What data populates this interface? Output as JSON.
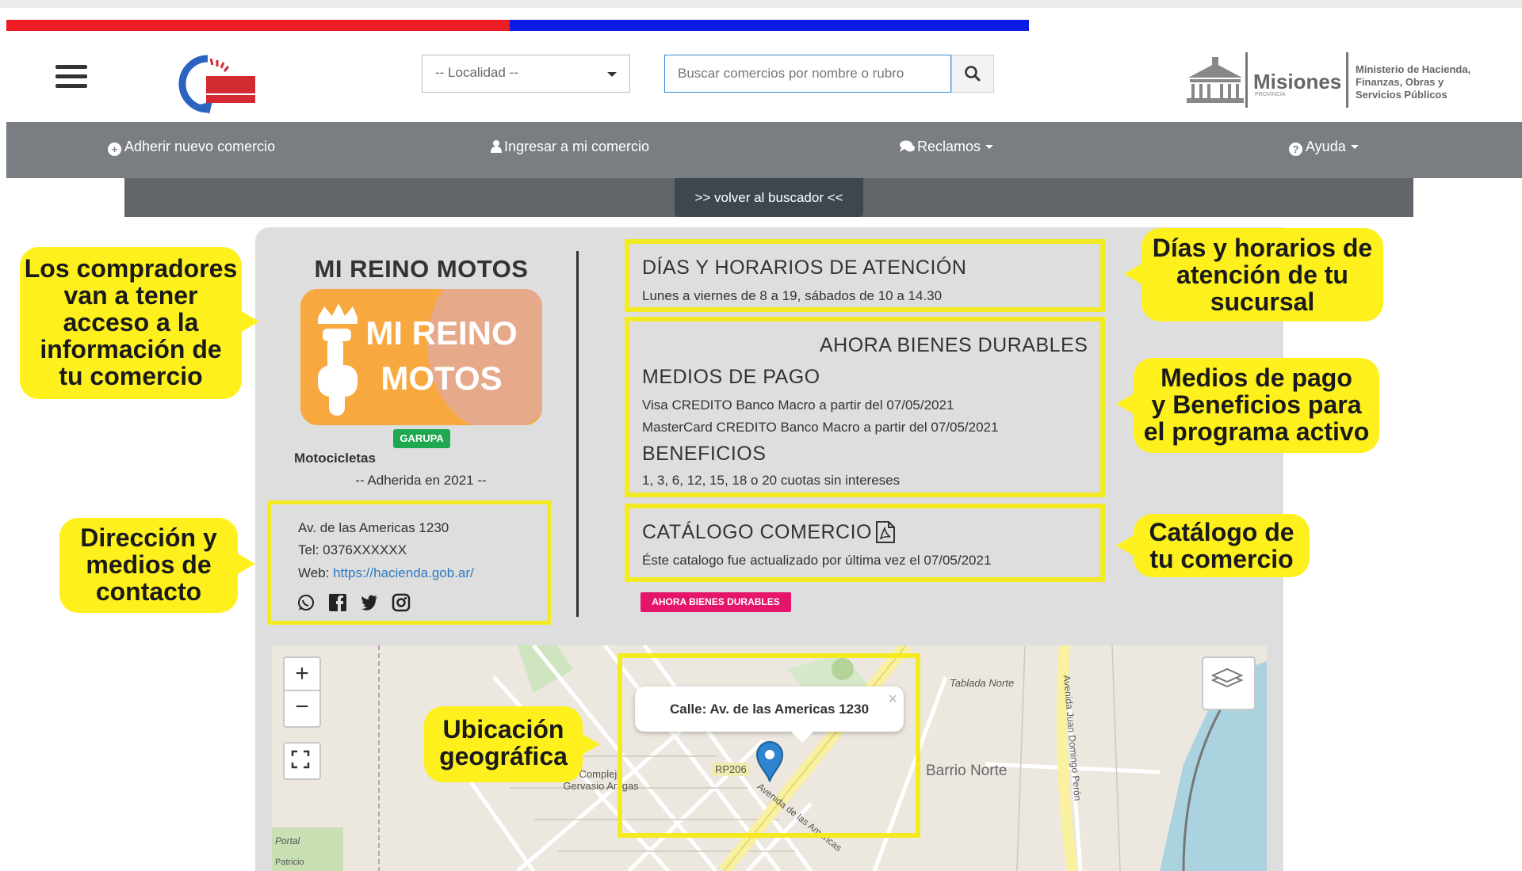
{
  "header": {
    "localidad_placeholder": "-- Localidad --",
    "search_placeholder": "Buscar comercios por nombre o rubro",
    "ministry_name": "Misiones",
    "ministry_subtitle": "PROVINCIA",
    "ministry_text": [
      "Ministerio de Hacienda,",
      "Finanzas, Obras y",
      "Servicios Públicos"
    ]
  },
  "nav": {
    "adherir": "Adherir nuevo comercio",
    "ingresar": "Ingresar a mi comercio",
    "reclamos": "Reclamos",
    "ayuda": "Ayuda",
    "volver": ">> volver al buscador <<"
  },
  "shop": {
    "name": "MI REINO MOTOS",
    "logo_text": [
      "MI REINO",
      "MOTOS"
    ],
    "locality_badge": "GARUPA",
    "category": "Motocicletas",
    "adherida": "-- Adherida en 2021 --",
    "address": "Av. de las Americas 1230",
    "tel": "Tel: 0376XXXXXX",
    "web_label": "Web: ",
    "web_url": "https://hacienda.gob.ar/"
  },
  "hours": {
    "title": "DÍAS Y HORARIOS DE ATENCIÓN",
    "text": "Lunes a viernes de 8 a 19, sábados de 10 a 14.30"
  },
  "payments": {
    "program": "AHORA BIENES DURABLES",
    "title": "MEDIOS DE PAGO",
    "items": [
      "Visa CREDITO Banco Macro a partir del 07/05/2021",
      "MasterCard CREDITO Banco Macro a partir del 07/05/2021"
    ],
    "benefits_title": "BENEFICIOS",
    "benefits_text": "1, 3, 6, 12, 15, 18 o 20 cuotas sin intereses"
  },
  "catalog": {
    "title": "CATÁLOGO COMERCIO",
    "text": "Éste catalogo fue actualizado por última vez el 07/05/2021"
  },
  "program_badge": "AHORA BIENES DURABLES",
  "map": {
    "popup": "Calle: Av. de las Americas 1230",
    "labels": [
      "RP206",
      "Barrio Norte",
      "Tablada Norte",
      "Complejo Gervasio Artigas",
      "Avenida de las Americas",
      "Avenida Juan Domingo Perón",
      "Portal",
      "Patricio"
    ],
    "zoom_in": "+",
    "zoom_out": "−"
  },
  "callouts": {
    "compradores": [
      "Los compradores",
      "van a tener",
      "acceso a la",
      "información de",
      "tu comercio"
    ],
    "direccion": [
      "Dirección y",
      "medios de",
      "contacto"
    ],
    "dias": [
      "Días y horarios de",
      "atención de tu",
      "sucursal"
    ],
    "medios": [
      "Medios de pago",
      "y Beneficios para",
      "el programa activo"
    ],
    "catalogo": [
      "Catálogo de",
      "tu comercio"
    ],
    "ubicacion": [
      "Ubicación",
      "geográfica"
    ]
  },
  "colors": {
    "callout_yellow": "#fdf01d",
    "nav_gray": "#7a7e83",
    "badge_green": "#1fa84f",
    "badge_pink": "#e5156c",
    "flag_red": "#ee1c25",
    "flag_blue": "#0a1be6"
  }
}
